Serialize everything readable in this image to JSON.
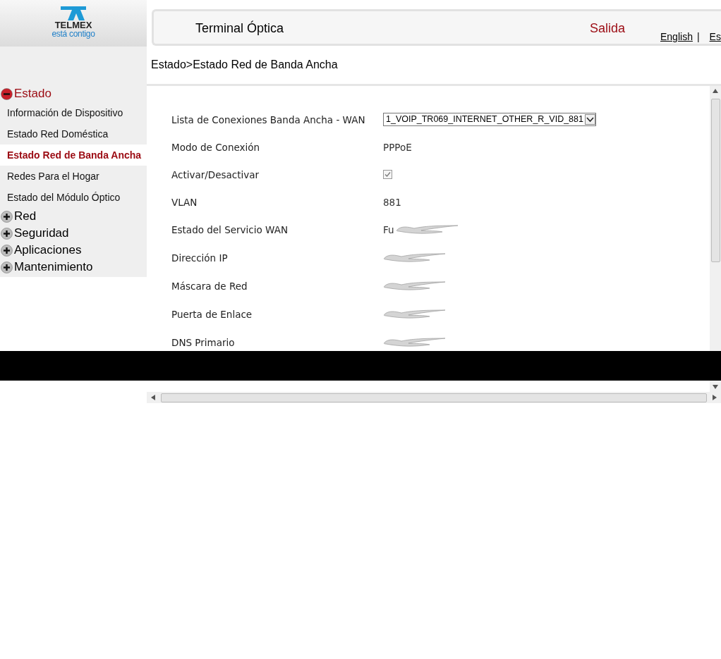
{
  "logo": {
    "brand": "TELMEX",
    "tagline": "está contigo"
  },
  "header": {
    "title": "Terminal Óptica",
    "logout": "Salida",
    "languages": [
      {
        "label": "English",
        "separator": "|"
      },
      {
        "label": "Es"
      }
    ]
  },
  "sidebar": {
    "groups": [
      {
        "label": "Estado",
        "expanded": true,
        "items": [
          {
            "label": "Información de Dispositivo",
            "selected": false
          },
          {
            "label": "Estado Red Doméstica",
            "selected": false
          },
          {
            "label": "Estado Red de Banda Ancha",
            "selected": true
          },
          {
            "label": "Redes Para el Hogar",
            "selected": false
          },
          {
            "label": "Estado del Módulo Óptico",
            "selected": false
          }
        ]
      },
      {
        "label": "Red",
        "expanded": false
      },
      {
        "label": "Seguridad",
        "expanded": false
      },
      {
        "label": "Aplicaciones",
        "expanded": false
      },
      {
        "label": "Mantenimiento",
        "expanded": false
      }
    ]
  },
  "breadcrumb": "Estado>Estado Red de Banda Ancha",
  "fields": [
    {
      "label": "Lista de Conexiones Banda Ancha - WAN",
      "kind": "select",
      "value": "1_VOIP_TR069_INTERNET_OTHER_R_VID_881"
    },
    {
      "label": "Modo de Conexión",
      "kind": "text",
      "value": "PPPoE"
    },
    {
      "label": "Activar/Desactivar",
      "kind": "checkbox",
      "checked": true
    },
    {
      "label": "VLAN",
      "kind": "text",
      "value": "881"
    },
    {
      "label": "Estado del Servicio WAN",
      "kind": "redacted",
      "value": "Fu"
    },
    {
      "label": "Dirección IP",
      "kind": "redacted"
    },
    {
      "label": "Máscara de Red",
      "kind": "redacted"
    },
    {
      "label": "Puerta de Enlace",
      "kind": "redacted"
    },
    {
      "label": "DNS Primario",
      "kind": "redacted"
    }
  ]
}
